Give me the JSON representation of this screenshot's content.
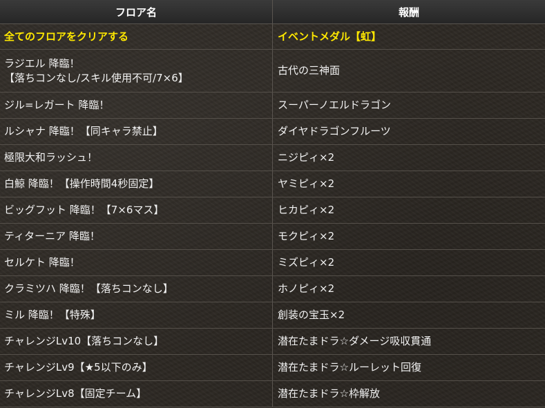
{
  "header": {
    "floor_label": "フロア名",
    "reward_label": "報酬"
  },
  "rows": [
    {
      "floor": "全てのフロアをクリアする",
      "floor2": "",
      "reward": "イベントメダル【虹】"
    },
    {
      "floor": "ラジエル 降臨！",
      "floor2": "【落ちコンなし/スキル使用不可/7×6】",
      "reward": "古代の三神面"
    },
    {
      "floor": "ジル=レガート 降臨！",
      "floor2": "",
      "reward": "スーパーノエルドラゴン"
    },
    {
      "floor": "ルシャナ 降臨！【同キャラ禁止】",
      "floor2": "",
      "reward": "ダイヤドラゴンフルーツ"
    },
    {
      "floor": "極限大和ラッシュ！",
      "floor2": "",
      "reward": "ニジピィ×2"
    },
    {
      "floor": "白鯨 降臨！【操作時間4秒固定】",
      "floor2": "",
      "reward": "ヤミピィ×2"
    },
    {
      "floor": "ビッグフット 降臨！【7×6マス】",
      "floor2": "",
      "reward": "ヒカピィ×2"
    },
    {
      "floor": "ティターニア 降臨！",
      "floor2": "",
      "reward": "モクピィ×2"
    },
    {
      "floor": "セルケト 降臨！",
      "floor2": "",
      "reward": "ミズピィ×2"
    },
    {
      "floor": "クラミツハ 降臨！【落ちコンなし】",
      "floor2": "",
      "reward": "ホノピィ×2"
    },
    {
      "floor": "ミル 降臨！【特殊】",
      "floor2": "",
      "reward": "創装の宝玉×2"
    },
    {
      "floor": "チャレンジLv10【落ちコンなし】",
      "floor2": "",
      "reward": "潜在たまドラ☆ダメージ吸収貫通"
    },
    {
      "floor": "チャレンジLv9【★5以下のみ】",
      "floor2": "",
      "reward": "潜在たまドラ☆ルーレット回復"
    },
    {
      "floor": "チャレンジLv8【固定チーム】",
      "floor2": "",
      "reward": "潜在たまドラ☆枠解放"
    }
  ],
  "colors": {
    "highlight_text": "#ffe800",
    "normal_text": "#f2f2f2",
    "header_bg": "#2f2f2f",
    "body_bg": "#2e2924"
  }
}
